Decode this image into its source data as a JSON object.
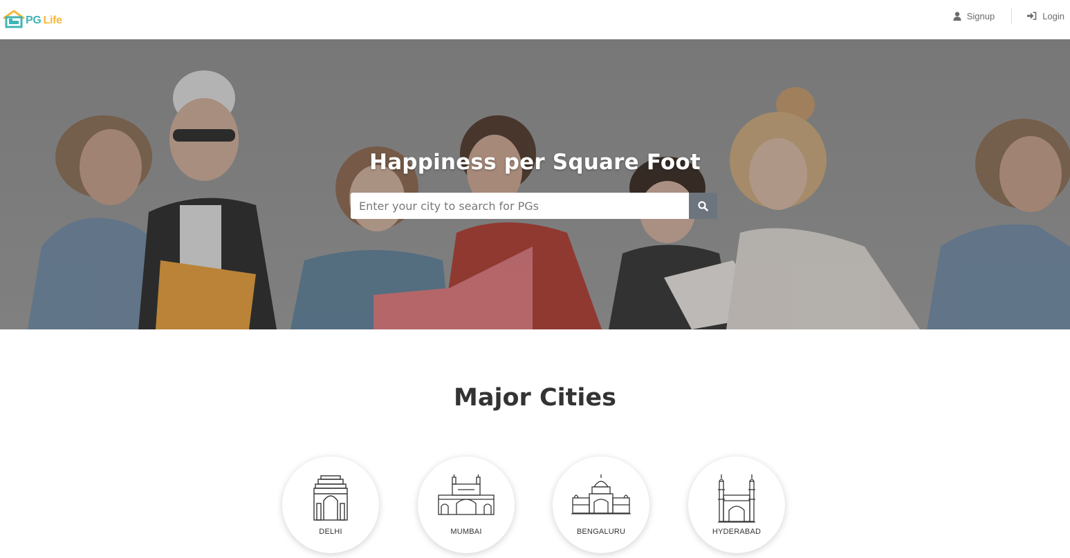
{
  "header": {
    "logo": {
      "pg": "PG",
      "life": "Life",
      "icon": "house-icon"
    },
    "nav": [
      {
        "label": "Signup",
        "icon": "user-icon"
      },
      {
        "label": "Login",
        "icon": "sign-in-icon"
      }
    ]
  },
  "hero": {
    "title": "Happiness per Square Foot",
    "search_placeholder": "Enter your city to search for PGs",
    "search_icon": "search-icon"
  },
  "major_cities": {
    "title": "Major Cities",
    "cities": [
      {
        "name": "DELHI",
        "icon": "india-gate-icon"
      },
      {
        "name": "MUMBAI",
        "icon": "gateway-of-india-icon"
      },
      {
        "name": "BENGALURU",
        "icon": "vidhana-soudha-icon"
      },
      {
        "name": "HYDERABAD",
        "icon": "charminar-icon"
      }
    ]
  },
  "colors": {
    "brand_teal": "#3fb5b5",
    "brand_yellow": "#f5b83a",
    "search_button": "#6c757d"
  }
}
